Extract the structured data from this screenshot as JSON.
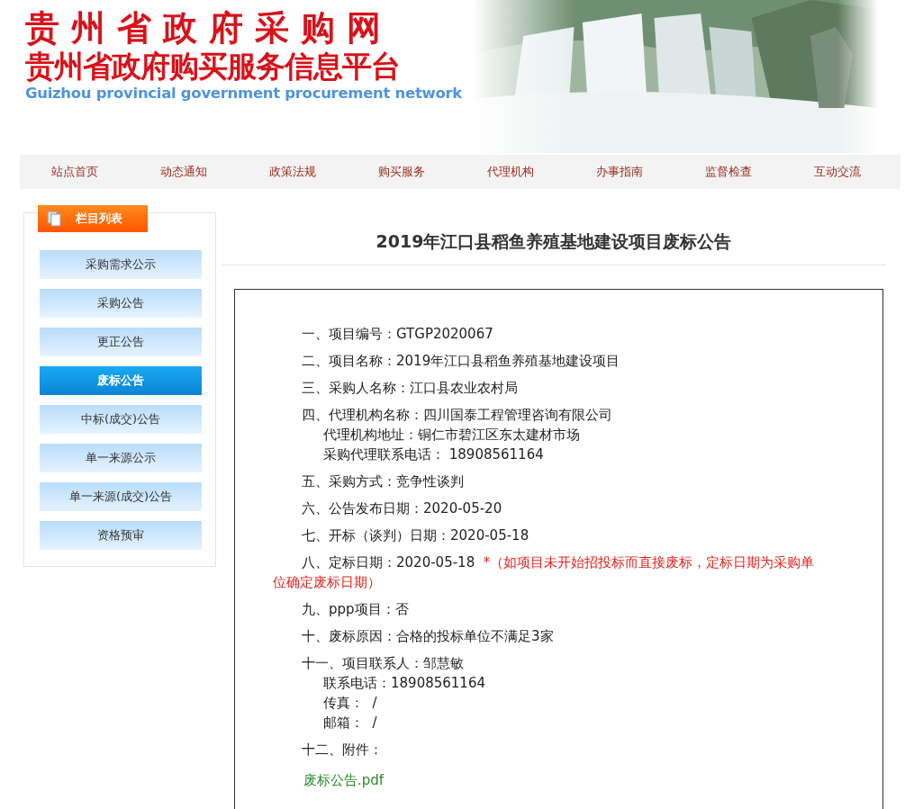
{
  "header": {
    "title": "贵州省政府采购网",
    "subtitle": "贵州省政府购买服务信息平台",
    "english": "Guizhou provincial government procurement network"
  },
  "nav": [
    "站点首页",
    "动态通知",
    "政策法规",
    "购买服务",
    "代理机构",
    "办事指南",
    "监督检查",
    "互动交流"
  ],
  "sidebar": {
    "title": "栏目列表",
    "items": [
      {
        "label": "采购需求公示",
        "selected": false
      },
      {
        "label": "采购公告",
        "selected": false
      },
      {
        "label": "更正公告",
        "selected": false
      },
      {
        "label": "废标公告",
        "selected": true
      },
      {
        "label": "中标(成交)公告",
        "selected": false
      },
      {
        "label": "单一来源公示",
        "selected": false
      },
      {
        "label": "单一来源(成交)公告",
        "selected": false
      },
      {
        "label": "资格预审",
        "selected": false
      }
    ]
  },
  "article": {
    "title": "2019年江口县稻鱼养殖基地建设项目废标公告",
    "sections": [
      {
        "text": "一、项目编号：GTGP2020067"
      },
      {
        "text": "二、项目名称：2019年江口县稻鱼养殖基地建设项目"
      },
      {
        "text": "三、采购人名称：江口县农业农村局"
      },
      {
        "text": "四、代理机构名称：四川国泰工程管理咨询有限公司",
        "lines": [
          "代理机构地址：铜仁市碧江区东太建材市场",
          "采购代理联系电话： 18908561164"
        ]
      },
      {
        "text": "五、采购方式：竞争性谈判"
      },
      {
        "text": "六、公告发布日期：2020-05-20"
      },
      {
        "text": "七、开标（谈判）日期：2020-05-18"
      },
      {
        "text": "八、定标日期：2020-05-18",
        "note": "*（如项目未开始招投标而直接废标，定标日期为采购单位确定废标日期）"
      },
      {
        "text": "九、ppp项目：否"
      },
      {
        "text": "十、废标原因：合格的投标单位不满足3家"
      },
      {
        "text": "十一、项目联系人：邹慧敏",
        "lines": [
          "联系电话：18908561164",
          "传真：  /",
          "邮箱：  /"
        ]
      },
      {
        "text": "十二、附件："
      }
    ],
    "attachment": "废标公告.pdf"
  }
}
